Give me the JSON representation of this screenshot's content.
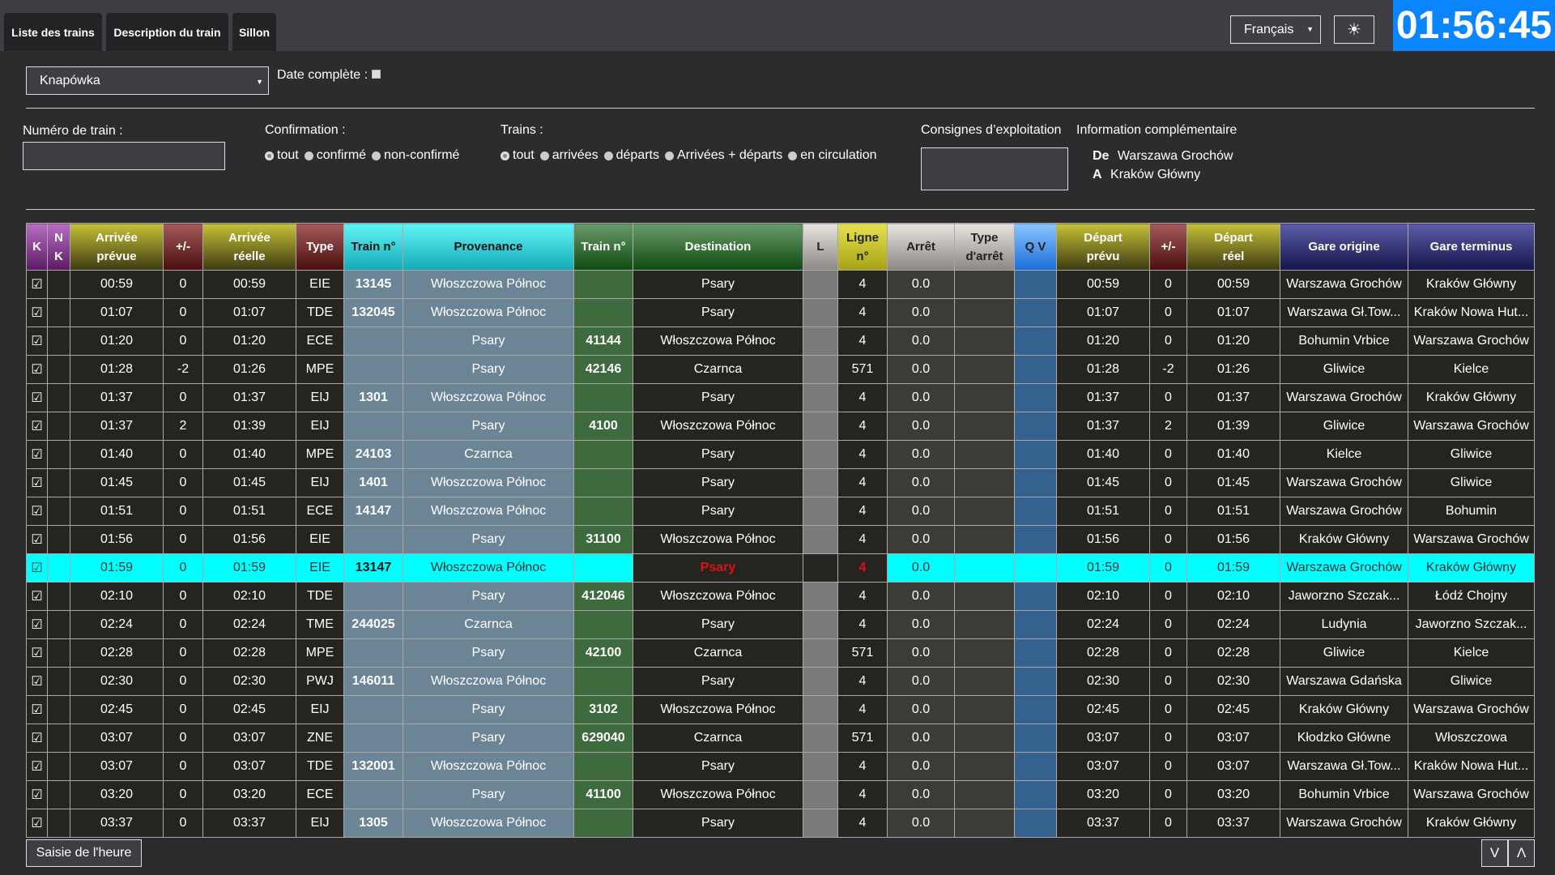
{
  "tabs": [
    {
      "label": "Liste des trains"
    },
    {
      "label": "Description du train"
    },
    {
      "label": "Sillon"
    }
  ],
  "header": {
    "language": "Français",
    "theme_icon": "☀",
    "clock": "01:56:45"
  },
  "filters": {
    "station": "Knapówka",
    "date_complete_label": "Date complète :",
    "date_complete_checked": false,
    "train_number_label": "Numéro de train :",
    "train_number_value": "",
    "confirmation_label": "Confirmation :",
    "confirmation_options": [
      "tout",
      "confirmé",
      "non-confirmé"
    ],
    "confirmation_selected": "tout",
    "trains_label": "Trains :",
    "trains_options": [
      "tout",
      "arrivées",
      "départs",
      "Arrivées + départs",
      "en circulation"
    ],
    "trains_selected": "tout",
    "consignes_label": "Consignes d’exploitation",
    "consignes_value": "",
    "info_label": "Information complémentaire",
    "info_from_label": "De",
    "info_from_value": "Warszawa Grochów",
    "info_to_label": "A",
    "info_to_value": "Kraków Główny"
  },
  "table": {
    "headers": {
      "k": "K",
      "nk_1": "N",
      "nk_2": "K",
      "arr_prevue_1": "Arrivée",
      "arr_prevue_2": "prévue",
      "arr_delta": "+/-",
      "arr_reelle_1": "Arrivée",
      "arr_reelle_2": "réelle",
      "type": "Type",
      "train_arr": "Train n°",
      "provenance": "Provenance",
      "train_dep": "Train n°",
      "destination": "Destination",
      "l": "L",
      "ligne_1": "Ligne",
      "ligne_2": "n°",
      "arret": "Arrêt",
      "type_arret_1": "Type",
      "type_arret_2": "d'arrêt",
      "qv": "Q V",
      "dep_prevu_1": "Départ",
      "dep_prevu_2": "prévu",
      "dep_delta": "+/-",
      "dep_reel_1": "Départ",
      "dep_reel_2": "réel",
      "gare_origine": "Gare origine",
      "gare_terminus": "Gare terminus"
    },
    "check_glyph": "☑",
    "highlighted_row": 10,
    "rows": [
      {
        "arr_prevue": "00:59",
        "arr_delta": "0",
        "arr_reelle": "00:59",
        "type": "EIE",
        "train_arr": "13145",
        "provenance": "Włoszczowa Północ",
        "train_dep": "",
        "destination": "Psary",
        "ligne": "4",
        "arret": "0.0",
        "dep_prevu": "00:59",
        "dep_delta": "0",
        "dep_reel": "00:59",
        "origine": "Warszawa Grochów",
        "terminus": "Kraków Główny"
      },
      {
        "arr_prevue": "01:07",
        "arr_delta": "0",
        "arr_reelle": "01:07",
        "type": "TDE",
        "train_arr": "132045",
        "provenance": "Włoszczowa Północ",
        "train_dep": "",
        "destination": "Psary",
        "ligne": "4",
        "arret": "0.0",
        "dep_prevu": "01:07",
        "dep_delta": "0",
        "dep_reel": "01:07",
        "origine": "Warszawa Gł.Tow...",
        "terminus": "Kraków Nowa Hut..."
      },
      {
        "arr_prevue": "01:20",
        "arr_delta": "0",
        "arr_reelle": "01:20",
        "type": "ECE",
        "train_arr": "",
        "provenance": "Psary",
        "train_dep": "41144",
        "destination": "Włoszczowa Północ",
        "ligne": "4",
        "arret": "0.0",
        "dep_prevu": "01:20",
        "dep_delta": "0",
        "dep_reel": "01:20",
        "origine": "Bohumin Vrbice",
        "terminus": "Warszawa Grochów"
      },
      {
        "arr_prevue": "01:28",
        "arr_delta": "-2",
        "arr_reelle": "01:26",
        "type": "MPE",
        "train_arr": "",
        "provenance": "Psary",
        "train_dep": "42146",
        "destination": "Czarnca",
        "ligne": "571",
        "arret": "0.0",
        "dep_prevu": "01:28",
        "dep_delta": "-2",
        "dep_reel": "01:26",
        "origine": "Gliwice",
        "terminus": "Kielce"
      },
      {
        "arr_prevue": "01:37",
        "arr_delta": "0",
        "arr_reelle": "01:37",
        "type": "EIJ",
        "train_arr": "1301",
        "provenance": "Włoszczowa Północ",
        "train_dep": "",
        "destination": "Psary",
        "ligne": "4",
        "arret": "0.0",
        "dep_prevu": "01:37",
        "dep_delta": "0",
        "dep_reel": "01:37",
        "origine": "Warszawa Grochów",
        "terminus": "Kraków Główny"
      },
      {
        "arr_prevue": "01:37",
        "arr_delta": "2",
        "arr_reelle": "01:39",
        "type": "EIJ",
        "train_arr": "",
        "provenance": "Psary",
        "train_dep": "4100",
        "destination": "Włoszczowa Północ",
        "ligne": "4",
        "arret": "0.0",
        "dep_prevu": "01:37",
        "dep_delta": "2",
        "dep_reel": "01:39",
        "origine": "Gliwice",
        "terminus": "Warszawa Grochów"
      },
      {
        "arr_prevue": "01:40",
        "arr_delta": "0",
        "arr_reelle": "01:40",
        "type": "MPE",
        "train_arr": "24103",
        "provenance": "Czarnca",
        "train_dep": "",
        "destination": "Psary",
        "ligne": "4",
        "arret": "0.0",
        "dep_prevu": "01:40",
        "dep_delta": "0",
        "dep_reel": "01:40",
        "origine": "Kielce",
        "terminus": "Gliwice"
      },
      {
        "arr_prevue": "01:45",
        "arr_delta": "0",
        "arr_reelle": "01:45",
        "type": "EIJ",
        "train_arr": "1401",
        "provenance": "Włoszczowa Północ",
        "train_dep": "",
        "destination": "Psary",
        "ligne": "4",
        "arret": "0.0",
        "dep_prevu": "01:45",
        "dep_delta": "0",
        "dep_reel": "01:45",
        "origine": "Warszawa Grochów",
        "terminus": "Gliwice"
      },
      {
        "arr_prevue": "01:51",
        "arr_delta": "0",
        "arr_reelle": "01:51",
        "type": "ECE",
        "train_arr": "14147",
        "provenance": "Włoszczowa Północ",
        "train_dep": "",
        "destination": "Psary",
        "ligne": "4",
        "arret": "0.0",
        "dep_prevu": "01:51",
        "dep_delta": "0",
        "dep_reel": "01:51",
        "origine": "Warszawa Grochów",
        "terminus": "Bohumin"
      },
      {
        "arr_prevue": "01:56",
        "arr_delta": "0",
        "arr_reelle": "01:56",
        "type": "EIE",
        "train_arr": "",
        "provenance": "Psary",
        "train_dep": "31100",
        "destination": "Włoszczowa Północ",
        "ligne": "4",
        "arret": "0.0",
        "dep_prevu": "01:56",
        "dep_delta": "0",
        "dep_reel": "01:56",
        "origine": "Kraków Główny",
        "terminus": "Warszawa Grochów"
      },
      {
        "arr_prevue": "01:59",
        "arr_delta": "0",
        "arr_reelle": "01:59",
        "type": "EIE",
        "train_arr": "13147",
        "provenance": "Włoszczowa Północ",
        "train_dep": "",
        "destination": "Psary",
        "ligne": "4",
        "arret": "0.0",
        "dep_prevu": "01:59",
        "dep_delta": "0",
        "dep_reel": "01:59",
        "origine": "Warszawa Grochów",
        "terminus": "Kraków Główny"
      },
      {
        "arr_prevue": "02:10",
        "arr_delta": "0",
        "arr_reelle": "02:10",
        "type": "TDE",
        "train_arr": "",
        "provenance": "Psary",
        "train_dep": "412046",
        "destination": "Włoszczowa Północ",
        "ligne": "4",
        "arret": "0.0",
        "dep_prevu": "02:10",
        "dep_delta": "0",
        "dep_reel": "02:10",
        "origine": "Jaworzno Szczak...",
        "terminus": "Łódź Chojny"
      },
      {
        "arr_prevue": "02:24",
        "arr_delta": "0",
        "arr_reelle": "02:24",
        "type": "TME",
        "train_arr": "244025",
        "provenance": "Czarnca",
        "train_dep": "",
        "destination": "Psary",
        "ligne": "4",
        "arret": "0.0",
        "dep_prevu": "02:24",
        "dep_delta": "0",
        "dep_reel": "02:24",
        "origine": "Ludynia",
        "terminus": "Jaworzno Szczak..."
      },
      {
        "arr_prevue": "02:28",
        "arr_delta": "0",
        "arr_reelle": "02:28",
        "type": "MPE",
        "train_arr": "",
        "provenance": "Psary",
        "train_dep": "42100",
        "destination": "Czarnca",
        "ligne": "571",
        "arret": "0.0",
        "dep_prevu": "02:28",
        "dep_delta": "0",
        "dep_reel": "02:28",
        "origine": "Gliwice",
        "terminus": "Kielce"
      },
      {
        "arr_prevue": "02:30",
        "arr_delta": "0",
        "arr_reelle": "02:30",
        "type": "PWJ",
        "train_arr": "146011",
        "provenance": "Włoszczowa Północ",
        "train_dep": "",
        "destination": "Psary",
        "ligne": "4",
        "arret": "0.0",
        "dep_prevu": "02:30",
        "dep_delta": "0",
        "dep_reel": "02:30",
        "origine": "Warszawa Gdańska",
        "terminus": "Gliwice"
      },
      {
        "arr_prevue": "02:45",
        "arr_delta": "0",
        "arr_reelle": "02:45",
        "type": "EIJ",
        "train_arr": "",
        "provenance": "Psary",
        "train_dep": "3102",
        "destination": "Włoszczowa Północ",
        "ligne": "4",
        "arret": "0.0",
        "dep_prevu": "02:45",
        "dep_delta": "0",
        "dep_reel": "02:45",
        "origine": "Kraków Główny",
        "terminus": "Warszawa Grochów"
      },
      {
        "arr_prevue": "03:07",
        "arr_delta": "0",
        "arr_reelle": "03:07",
        "type": "ZNE",
        "train_arr": "",
        "provenance": "Psary",
        "train_dep": "629040",
        "destination": "Czarnca",
        "ligne": "571",
        "arret": "0.0",
        "dep_prevu": "03:07",
        "dep_delta": "0",
        "dep_reel": "03:07",
        "origine": "Kłodzko Główne",
        "terminus": "Włoszczowa"
      },
      {
        "arr_prevue": "03:07",
        "arr_delta": "0",
        "arr_reelle": "03:07",
        "type": "TDE",
        "train_arr": "132001",
        "provenance": "Włoszczowa Północ",
        "train_dep": "",
        "destination": "Psary",
        "ligne": "4",
        "arret": "0.0",
        "dep_prevu": "03:07",
        "dep_delta": "0",
        "dep_reel": "03:07",
        "origine": "Warszawa Gł.Tow...",
        "terminus": "Kraków Nowa Hut..."
      },
      {
        "arr_prevue": "03:20",
        "arr_delta": "0",
        "arr_reelle": "03:20",
        "type": "ECE",
        "train_arr": "",
        "provenance": "Psary",
        "train_dep": "41100",
        "destination": "Włoszczowa Północ",
        "ligne": "4",
        "arret": "0.0",
        "dep_prevu": "03:20",
        "dep_delta": "0",
        "dep_reel": "03:20",
        "origine": "Bohumin Vrbice",
        "terminus": "Warszawa Grochów"
      },
      {
        "arr_prevue": "03:37",
        "arr_delta": "0",
        "arr_reelle": "03:37",
        "type": "EIJ",
        "train_arr": "1305",
        "provenance": "Włoszczowa Północ",
        "train_dep": "",
        "destination": "Psary",
        "ligne": "4",
        "arret": "0.0",
        "dep_prevu": "03:37",
        "dep_delta": "0",
        "dep_reel": "03:37",
        "origine": "Warszawa Grochów",
        "terminus": "Kraków Główny"
      }
    ]
  },
  "footer": {
    "saisie_label": "Saisie de l'heure",
    "scroll_down_label": "V",
    "scroll_up_label": "Λ"
  },
  "colors": {
    "clock_bg": "#0a84ff",
    "highlight_row": "#00ffff",
    "highlight_text": "#e01010"
  }
}
